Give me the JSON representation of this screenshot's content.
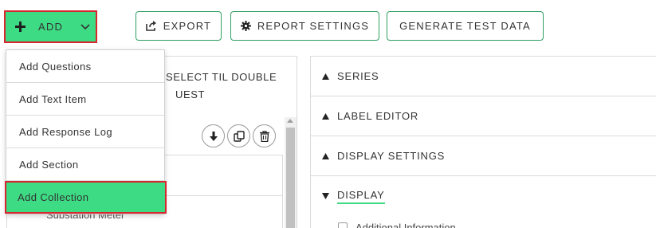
{
  "toolbar": {
    "add_label": "ADD",
    "export_label": "EXPORT",
    "report_settings_label": "REPORT SETTINGS",
    "generate_label": "GENERATE TEST DATA"
  },
  "add_menu": {
    "items": [
      {
        "label": "Add Questions"
      },
      {
        "label": "Add Text Item"
      },
      {
        "label": "Add Response Log"
      },
      {
        "label": "Add Section"
      },
      {
        "label": "Add Collection"
      }
    ],
    "selected": "Add Collection"
  },
  "left_panel": {
    "title_line1": "SELECT TIL DOUBLE",
    "title_line2": "UEST",
    "obscured_item": "Substation Meter"
  },
  "right_panel": {
    "sections": [
      {
        "label": "SERIES",
        "state": "collapsed"
      },
      {
        "label": "LABEL EDITOR",
        "state": "collapsed"
      },
      {
        "label": "DISPLAY SETTINGS",
        "state": "collapsed"
      },
      {
        "label": "DISPLAY",
        "state": "expanded"
      }
    ],
    "sub_item": "Additional Information"
  },
  "colors": {
    "accent_green": "#3ddc84",
    "border_green": "#2f9e63",
    "highlight_red": "#d7262e"
  },
  "icons": {
    "add": "plus-icon",
    "chevron": "chevron-down-icon",
    "export": "export-icon",
    "settings": "gear-icon",
    "download": "download-icon",
    "copy": "copy-icon",
    "delete": "trash-icon"
  }
}
